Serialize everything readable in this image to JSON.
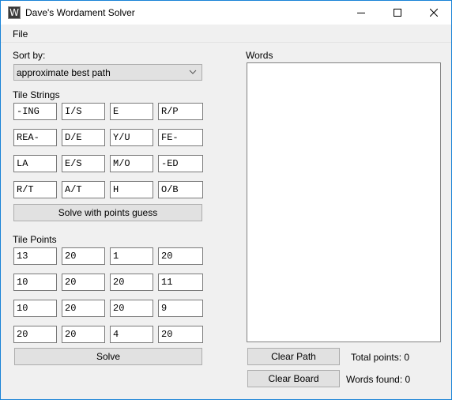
{
  "window": {
    "title": "Dave's Wordament Solver",
    "app_icon_glyph": "W",
    "controls": {
      "minimize": "minimize-icon",
      "maximize": "maximize-icon",
      "close": "close-icon"
    }
  },
  "menu": {
    "items": [
      {
        "label": "File"
      }
    ]
  },
  "sort": {
    "label": "Sort by:",
    "selected": "approximate best path"
  },
  "tile_strings": {
    "label": "Tile Strings",
    "rows": [
      [
        "-ING",
        "I/S",
        "E",
        "R/P"
      ],
      [
        "REA-",
        "D/E",
        "Y/U",
        "FE-"
      ],
      [
        "LA",
        "E/S",
        "M/O",
        "-ED"
      ],
      [
        "R/T",
        "A/T",
        "H",
        "O/B"
      ]
    ],
    "solve_guess_label": "Solve with points guess"
  },
  "tile_points": {
    "label": "Tile Points",
    "rows": [
      [
        "13",
        "20",
        "1",
        "20"
      ],
      [
        "10",
        "20",
        "20",
        "11"
      ],
      [
        "10",
        "20",
        "20",
        "9"
      ],
      [
        "20",
        "20",
        "4",
        "20"
      ]
    ],
    "solve_label": "Solve"
  },
  "words": {
    "label": "Words",
    "items": [],
    "clear_path_label": "Clear Path",
    "clear_board_label": "Clear Board",
    "total_points_text": "Total points: 0",
    "words_found_text": "Words found: 0"
  }
}
